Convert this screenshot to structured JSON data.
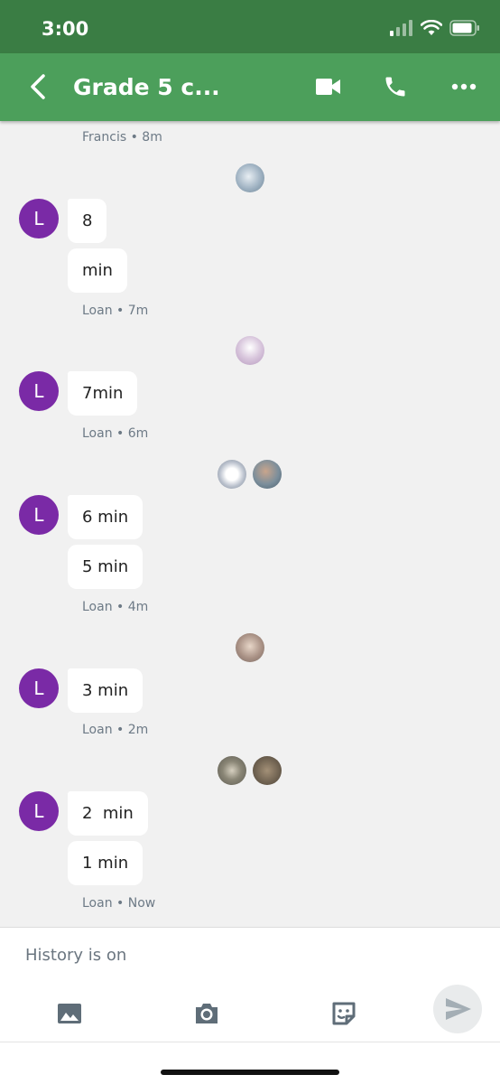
{
  "status": {
    "time": "3:00"
  },
  "header": {
    "title": "Grade 5 c..."
  },
  "messages": {
    "francis_meta": "Francis • 8m",
    "avatar_letter": "L",
    "groups": [
      {
        "bubbles": [
          "8",
          "min"
        ],
        "meta": "Loan • 7m"
      },
      {
        "bubbles": [
          "7min"
        ],
        "meta": "Loan • 6m"
      },
      {
        "bubbles": [
          "6 min",
          "5 min"
        ],
        "meta": "Loan • 4m"
      },
      {
        "bubbles": [
          "3 min"
        ],
        "meta": "Loan • 2m"
      },
      {
        "bubbles": [
          "2  min",
          "1 min"
        ],
        "meta": "Loan • Now"
      }
    ]
  },
  "composer": {
    "placeholder": "History is on"
  },
  "colors": {
    "status_bar": "#3a7d44",
    "app_bar": "#4c9f5b",
    "avatar": "#7a2aa6",
    "background": "#f1f1f1"
  },
  "icons": [
    "back-arrow-icon",
    "video-camera-icon",
    "phone-icon",
    "more-options-icon",
    "image-icon",
    "camera-icon",
    "sticker-icon",
    "send-icon"
  ]
}
